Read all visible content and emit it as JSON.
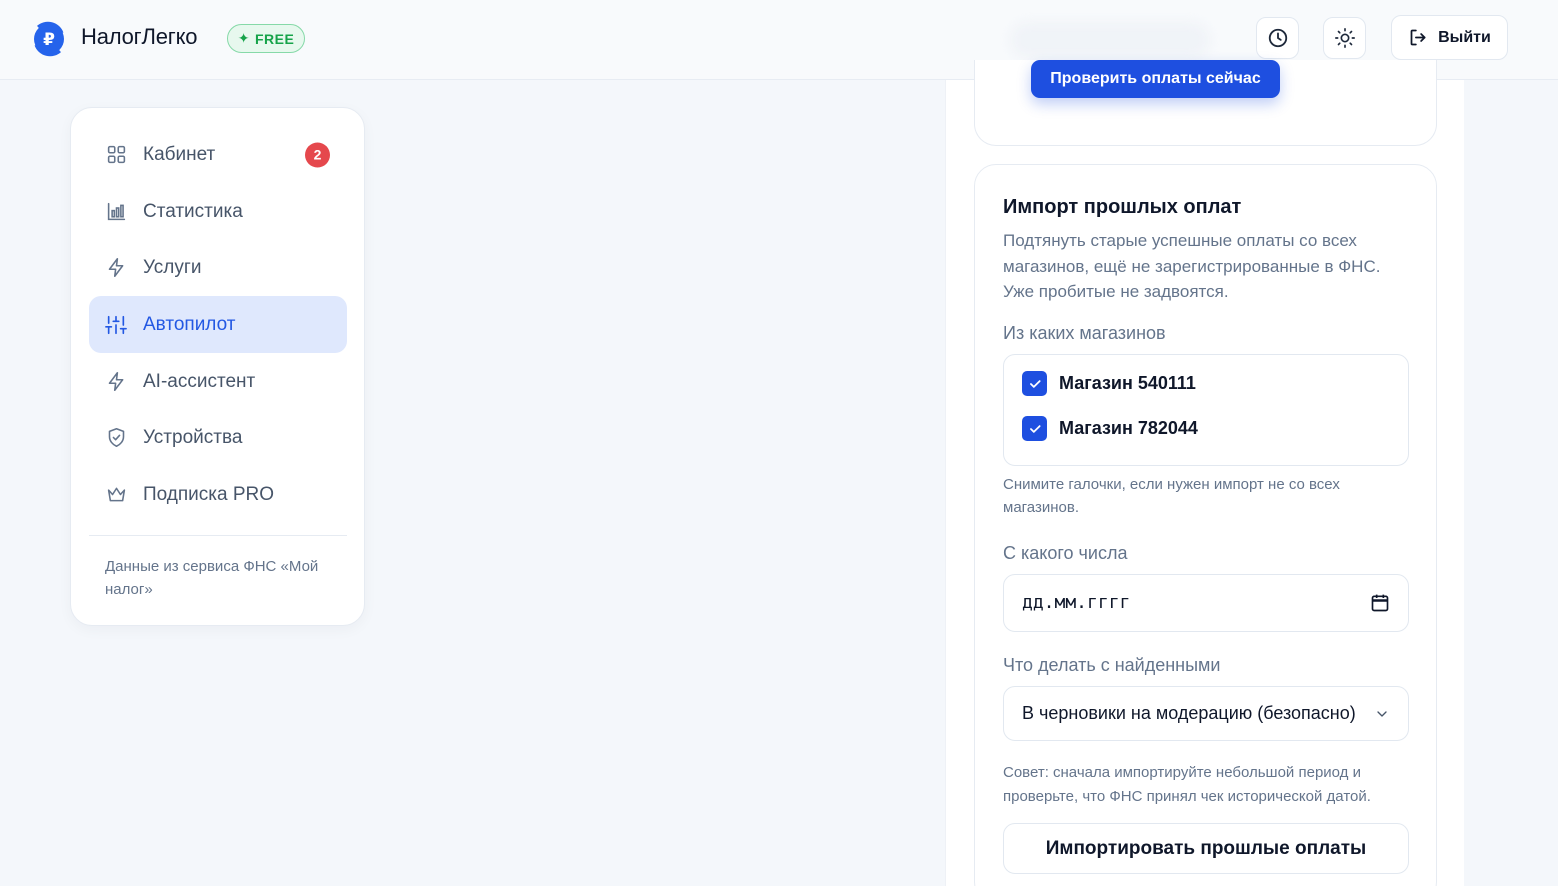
{
  "header": {
    "brand": "НалогЛегко",
    "plan_badge": "FREE",
    "history_icon": "clock-icon",
    "theme_icon": "sun-icon",
    "logout_label": "Выйти",
    "accent": "#1e4fe0"
  },
  "sidebar": {
    "items": [
      {
        "label": "Кабинет",
        "icon": "grid-icon",
        "badge": "2"
      },
      {
        "label": "Статистика",
        "icon": "bar-chart-icon"
      },
      {
        "label": "Услуги",
        "icon": "lightning-icon"
      },
      {
        "label": "Автопилот",
        "icon": "sliders-icon",
        "active": true
      },
      {
        "label": "AI-ассистент",
        "icon": "lightning-icon"
      },
      {
        "label": "Устройства",
        "icon": "shield-check-icon"
      },
      {
        "label": "Подписка PRO",
        "icon": "crown-icon"
      }
    ],
    "footer": "Данные из сервиса ФНС «Мой налог»"
  },
  "main": {
    "check_button": "Проверить оплаты сейчас",
    "import": {
      "title": "Импорт прошлых оплат",
      "description": "Подтянуть старые успешные оплаты со всех магазинов, ещё не зарегистрированные в ФНС. Уже пробитые не задвоятся.",
      "stores_label": "Из каких магазинов",
      "stores": [
        {
          "name": "Магазин 540111",
          "checked": true
        },
        {
          "name": "Магазин 782044",
          "checked": true
        }
      ],
      "stores_hint": "Снимите галочки, если нужен импорт не со всех магазинов.",
      "date_label": "С какого числа",
      "date_placeholder": "дд.мм.гггг",
      "action_label": "Что делать с найденными",
      "action_value": "В черновики на модерацию (безопасно)",
      "tip": "Совет: сначала импортируйте небольшой период и проверьте, что ФНС принял чек исторической датой.",
      "import_button": "Импортировать прошлые оплаты"
    }
  }
}
